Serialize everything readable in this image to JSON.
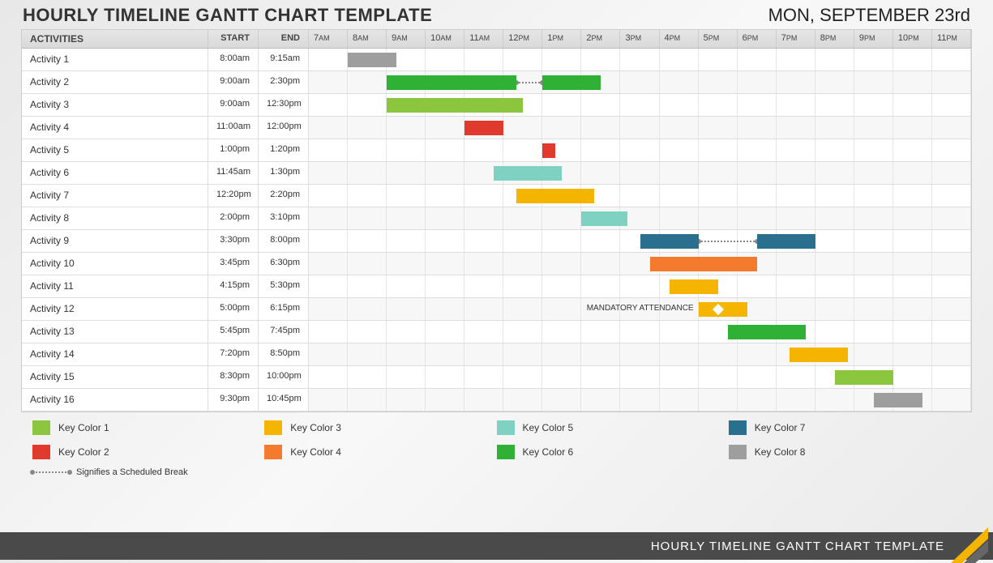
{
  "title": "HOURLY TIMELINE GANTT CHART TEMPLATE",
  "date": "MON, SEPTEMBER 23rd",
  "columns": {
    "activities": "ACTIVITIES",
    "start": "START",
    "end": "END"
  },
  "timeAxis": {
    "startHour": 7,
    "endHour": 24
  },
  "timeLabels": [
    "7AM",
    "8AM",
    "9AM",
    "10AM",
    "11AM",
    "12PM",
    "1PM",
    "2PM",
    "3PM",
    "4PM",
    "5PM",
    "6PM",
    "7PM",
    "8PM",
    "9PM",
    "10PM",
    "11PM"
  ],
  "colors": {
    "c1": "#8cc63f",
    "c2": "#e03a2e",
    "c3": "#f4b400",
    "c4": "#f47a2e",
    "c5": "#7fd1c1",
    "c6": "#2eb135",
    "c7": "#2b6f8f",
    "c8": "#9e9e9e"
  },
  "activities": [
    {
      "name": "Activity 1",
      "start": "8:00am",
      "end": "9:15am",
      "segments": [
        {
          "startHour": 8.0,
          "endHour": 9.25,
          "color": "c8"
        }
      ]
    },
    {
      "name": "Activity 2",
      "start": "9:00am",
      "end": "2:30pm",
      "segments": [
        {
          "startHour": 9.0,
          "endHour": 12.33,
          "color": "c6"
        },
        {
          "startHour": 13.0,
          "endHour": 14.5,
          "color": "c6"
        }
      ],
      "break": {
        "startHour": 12.33,
        "endHour": 13.0
      }
    },
    {
      "name": "Activity 3",
      "start": "9:00am",
      "end": "12:30pm",
      "segments": [
        {
          "startHour": 9.0,
          "endHour": 12.5,
          "color": "c1"
        }
      ]
    },
    {
      "name": "Activity 4",
      "start": "11:00am",
      "end": "12:00pm",
      "segments": [
        {
          "startHour": 11.0,
          "endHour": 12.0,
          "color": "c2"
        }
      ]
    },
    {
      "name": "Activity 5",
      "start": "1:00pm",
      "end": "1:20pm",
      "segments": [
        {
          "startHour": 13.0,
          "endHour": 13.33,
          "color": "c2"
        }
      ]
    },
    {
      "name": "Activity 6",
      "start": "11:45am",
      "end": "1:30pm",
      "segments": [
        {
          "startHour": 11.75,
          "endHour": 13.5,
          "color": "c5"
        }
      ]
    },
    {
      "name": "Activity 7",
      "start": "12:20pm",
      "end": "2:20pm",
      "segments": [
        {
          "startHour": 12.33,
          "endHour": 14.33,
          "color": "c3"
        }
      ]
    },
    {
      "name": "Activity 8",
      "start": "2:00pm",
      "end": "3:10pm",
      "segments": [
        {
          "startHour": 14.0,
          "endHour": 15.17,
          "color": "c5"
        }
      ]
    },
    {
      "name": "Activity 9",
      "start": "3:30pm",
      "end": "8:00pm",
      "segments": [
        {
          "startHour": 15.5,
          "endHour": 17.0,
          "color": "c7"
        },
        {
          "startHour": 18.5,
          "endHour": 20.0,
          "color": "c7"
        }
      ],
      "break": {
        "startHour": 17.0,
        "endHour": 18.5
      }
    },
    {
      "name": "Activity 10",
      "start": "3:45pm",
      "end": "6:30pm",
      "segments": [
        {
          "startHour": 15.75,
          "endHour": 18.5,
          "color": "c4"
        }
      ]
    },
    {
      "name": "Activity 11",
      "start": "4:15pm",
      "end": "5:30pm",
      "segments": [
        {
          "startHour": 16.25,
          "endHour": 17.5,
          "color": "c3"
        }
      ]
    },
    {
      "name": "Activity 12",
      "start": "5:00pm",
      "end": "6:15pm",
      "segments": [
        {
          "startHour": 17.0,
          "endHour": 18.25,
          "color": "c3"
        }
      ],
      "note": "MANDATORY ATTENDANCE",
      "diamondHour": 17.5
    },
    {
      "name": "Activity 13",
      "start": "5:45pm",
      "end": "7:45pm",
      "segments": [
        {
          "startHour": 17.75,
          "endHour": 19.75,
          "color": "c6"
        }
      ]
    },
    {
      "name": "Activity 14",
      "start": "7:20pm",
      "end": "8:50pm",
      "segments": [
        {
          "startHour": 19.33,
          "endHour": 20.83,
          "color": "c3"
        }
      ]
    },
    {
      "name": "Activity 15",
      "start": "8:30pm",
      "end": "10:00pm",
      "segments": [
        {
          "startHour": 20.5,
          "endHour": 22.0,
          "color": "c1"
        }
      ]
    },
    {
      "name": "Activity 16",
      "start": "9:30pm",
      "end": "10:45pm",
      "segments": [
        {
          "startHour": 21.5,
          "endHour": 22.75,
          "color": "c8"
        }
      ]
    }
  ],
  "legend": [
    {
      "label": "Key Color 1",
      "color": "c1"
    },
    {
      "label": "Key Color 3",
      "color": "c3"
    },
    {
      "label": "Key Color 5",
      "color": "c5"
    },
    {
      "label": "Key Color 7",
      "color": "c7"
    },
    {
      "label": "Key Color 2",
      "color": "c2"
    },
    {
      "label": "Key Color 4",
      "color": "c4"
    },
    {
      "label": "Key Color 6",
      "color": "c6"
    },
    {
      "label": "Key Color 8",
      "color": "c8"
    }
  ],
  "breakLegend": "Signifies a Scheduled Break",
  "footer": "HOURLY TIMELINE GANTT CHART TEMPLATE",
  "chart_data": {
    "type": "gantt",
    "title": "Hourly Timeline Gantt Chart Template",
    "x_axis": {
      "unit": "hour",
      "start": 7,
      "end": 24,
      "labels": [
        "7AM",
        "8AM",
        "9AM",
        "10AM",
        "11AM",
        "12PM",
        "1PM",
        "2PM",
        "3PM",
        "4PM",
        "5PM",
        "6PM",
        "7PM",
        "8PM",
        "9PM",
        "10PM",
        "11PM"
      ]
    },
    "tasks": [
      {
        "name": "Activity 1",
        "start": 8.0,
        "end": 9.25,
        "category": "Key Color 8"
      },
      {
        "name": "Activity 2",
        "start": 9.0,
        "end": 14.5,
        "category": "Key Color 6",
        "break": [
          12.33,
          13.0
        ]
      },
      {
        "name": "Activity 3",
        "start": 9.0,
        "end": 12.5,
        "category": "Key Color 1"
      },
      {
        "name": "Activity 4",
        "start": 11.0,
        "end": 12.0,
        "category": "Key Color 2"
      },
      {
        "name": "Activity 5",
        "start": 13.0,
        "end": 13.33,
        "category": "Key Color 2"
      },
      {
        "name": "Activity 6",
        "start": 11.75,
        "end": 13.5,
        "category": "Key Color 5"
      },
      {
        "name": "Activity 7",
        "start": 12.33,
        "end": 14.33,
        "category": "Key Color 3"
      },
      {
        "name": "Activity 8",
        "start": 14.0,
        "end": 15.17,
        "category": "Key Color 5"
      },
      {
        "name": "Activity 9",
        "start": 15.5,
        "end": 20.0,
        "category": "Key Color 7",
        "break": [
          17.0,
          18.5
        ]
      },
      {
        "name": "Activity 10",
        "start": 15.75,
        "end": 18.5,
        "category": "Key Color 4"
      },
      {
        "name": "Activity 11",
        "start": 16.25,
        "end": 17.5,
        "category": "Key Color 3"
      },
      {
        "name": "Activity 12",
        "start": 17.0,
        "end": 18.25,
        "category": "Key Color 3",
        "annotation": "MANDATORY ATTENDANCE",
        "milestone": 17.5
      },
      {
        "name": "Activity 13",
        "start": 17.75,
        "end": 19.75,
        "category": "Key Color 6"
      },
      {
        "name": "Activity 14",
        "start": 19.33,
        "end": 20.83,
        "category": "Key Color 3"
      },
      {
        "name": "Activity 15",
        "start": 20.5,
        "end": 22.0,
        "category": "Key Color 1"
      },
      {
        "name": "Activity 16",
        "start": 21.5,
        "end": 22.75,
        "category": "Key Color 8"
      }
    ],
    "legend": [
      "Key Color 1",
      "Key Color 2",
      "Key Color 3",
      "Key Color 4",
      "Key Color 5",
      "Key Color 6",
      "Key Color 7",
      "Key Color 8"
    ]
  }
}
